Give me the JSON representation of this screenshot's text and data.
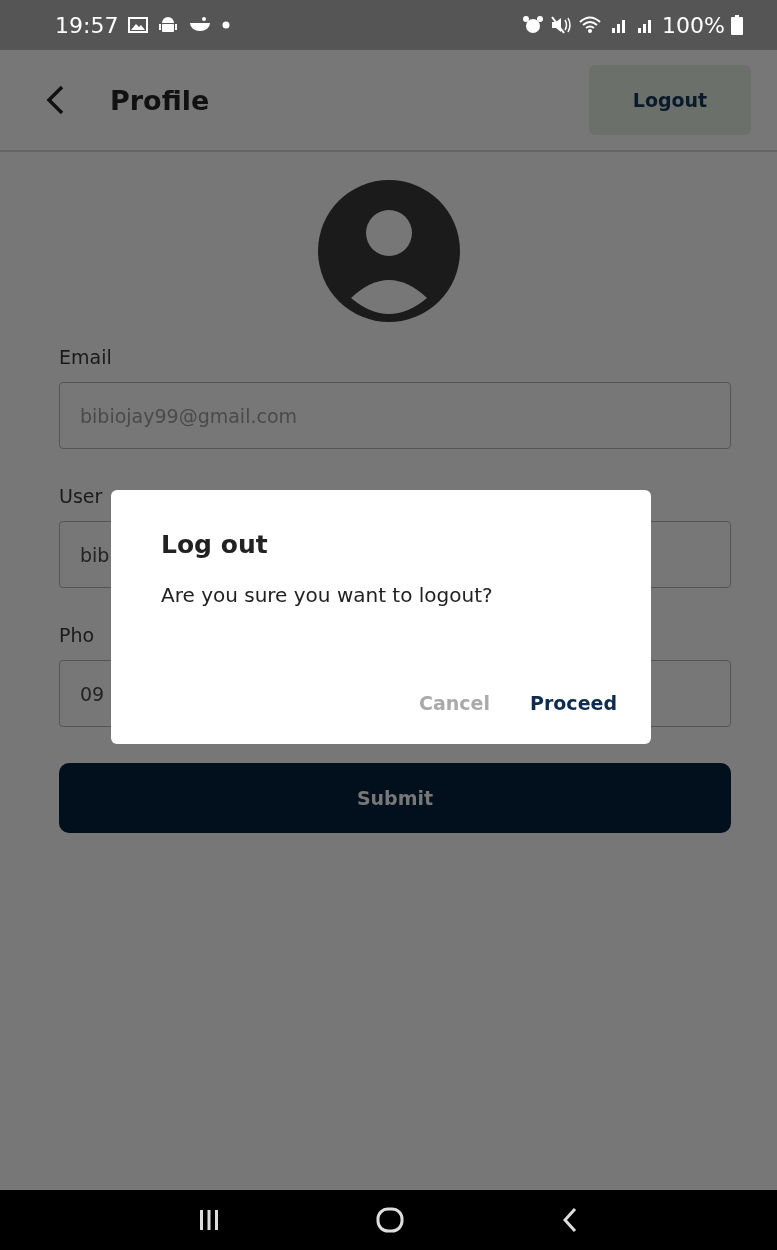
{
  "status_bar": {
    "time": "19:57",
    "battery": "100%"
  },
  "header": {
    "title": "Profile",
    "logout_button": "Logout"
  },
  "form": {
    "fields": [
      {
        "label": "Email",
        "value": "bibiojay99@gmail.com"
      },
      {
        "label": "User",
        "value": "bib"
      },
      {
        "label": "Pho",
        "value": "09"
      }
    ],
    "submit_button": "Submit"
  },
  "dialog": {
    "title": "Log out",
    "message": "Are you sure you want to logout?",
    "buttons": [
      {
        "label": "Cancel",
        "kind": "cancel"
      },
      {
        "label": "Proceed",
        "kind": "confirm"
      }
    ]
  }
}
